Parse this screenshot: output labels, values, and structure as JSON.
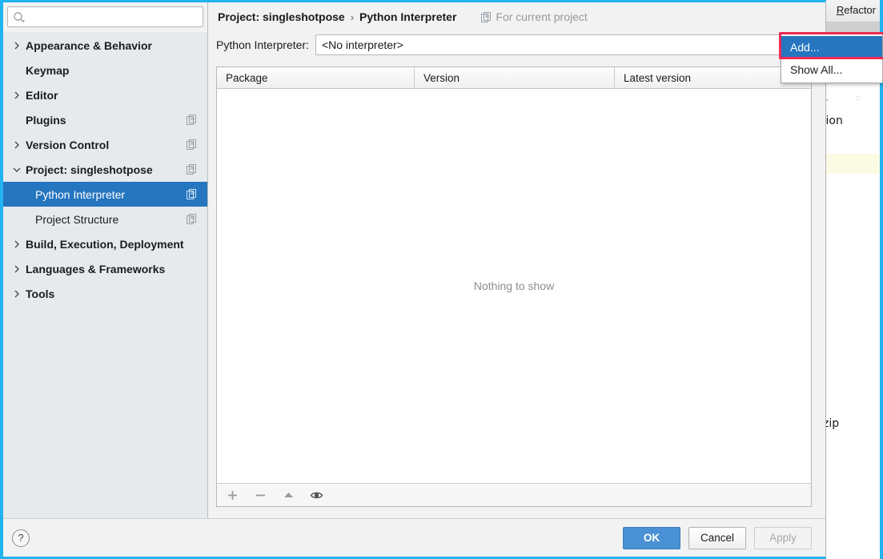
{
  "ide": {
    "menu_refactor": "Refactor",
    "menu_refactor_mnemonic": "R",
    "code_fragment_1": "tion",
    "code_fragment_2": "zip",
    "accent_cyan": "#21b3ef"
  },
  "dialog": {
    "search": {
      "placeholder": "",
      "value": "",
      "icon": "search-icon"
    },
    "sidebar": {
      "items": [
        {
          "label": "Appearance & Behavior",
          "arrow": "chevron-right",
          "bold": true,
          "child": false,
          "badge": false,
          "selected": false
        },
        {
          "label": "Keymap",
          "arrow": "none",
          "bold": true,
          "child": false,
          "badge": false,
          "selected": false
        },
        {
          "label": "Editor",
          "arrow": "chevron-right",
          "bold": true,
          "child": false,
          "badge": false,
          "selected": false
        },
        {
          "label": "Plugins",
          "arrow": "none",
          "bold": true,
          "child": false,
          "badge": true,
          "selected": false
        },
        {
          "label": "Version Control",
          "arrow": "chevron-right",
          "bold": true,
          "child": false,
          "badge": true,
          "selected": false
        },
        {
          "label": "Project: singleshotpose",
          "arrow": "chevron-down",
          "bold": true,
          "child": false,
          "badge": true,
          "selected": false
        },
        {
          "label": "Python Interpreter",
          "arrow": "none",
          "bold": false,
          "child": true,
          "badge": true,
          "selected": true
        },
        {
          "label": "Project Structure",
          "arrow": "none",
          "bold": false,
          "child": true,
          "badge": true,
          "selected": false
        },
        {
          "label": "Build, Execution, Deployment",
          "arrow": "chevron-right",
          "bold": true,
          "child": false,
          "badge": false,
          "selected": false
        },
        {
          "label": "Languages & Frameworks",
          "arrow": "chevron-right",
          "bold": true,
          "child": false,
          "badge": false,
          "selected": false
        },
        {
          "label": "Tools",
          "arrow": "chevron-right",
          "bold": true,
          "child": false,
          "badge": false,
          "selected": false
        }
      ],
      "selected_color": "#2675bf"
    },
    "breadcrumb": {
      "project": "Project: singleshotpose",
      "separator": "›",
      "page": "Python Interpreter",
      "scope": "For current project"
    },
    "interpreter": {
      "label": "Python Interpreter:",
      "value": "<No interpreter>"
    },
    "packages": {
      "columns": [
        "Package",
        "Version",
        "Latest version"
      ],
      "rows": [],
      "empty_message": "Nothing to show",
      "toolbar": [
        "add-icon",
        "remove-icon",
        "upgrade-icon",
        "show-early-releases-icon"
      ]
    },
    "footer": {
      "help": "?",
      "ok": "OK",
      "cancel": "Cancel",
      "apply": "Apply",
      "apply_disabled": true,
      "ok_color": "#4a90d4"
    }
  },
  "popup": {
    "items": [
      {
        "label": "Add...",
        "highlighted": true
      },
      {
        "label": "Show All...",
        "highlighted": false
      }
    ],
    "annotation_color": "#ef2a53"
  }
}
